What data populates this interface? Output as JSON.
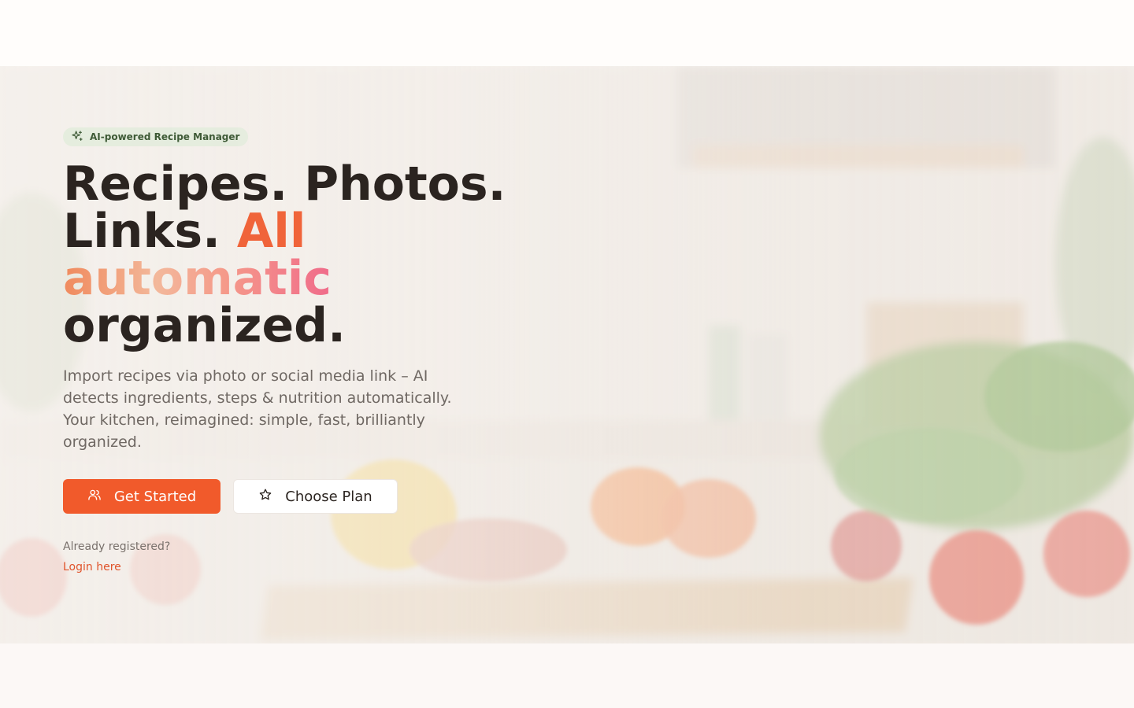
{
  "badge": {
    "icon": "sparkles-icon",
    "label": "AI-powered Recipe Manager"
  },
  "headline": {
    "part1": "Recipes. Photos.",
    "part2": "Links.",
    "accent": "All",
    "gradient_word": "automatic",
    "part3": "organized."
  },
  "subtitle": "Import recipes via photo or social media link – AI detects ingredients, steps & nutrition automatically. Your kitchen, reimagined: simple, fast, brilliantly organized.",
  "actions": {
    "primary": {
      "icon": "users-icon",
      "label": "Get Started"
    },
    "secondary": {
      "icon": "star-icon",
      "label": "Choose Plan"
    }
  },
  "login": {
    "prompt": "Already registered?",
    "link": "Login here"
  },
  "colors": {
    "brand": "#f15a2b",
    "heading": "#2b2420",
    "badge_text": "#3e5a36"
  }
}
